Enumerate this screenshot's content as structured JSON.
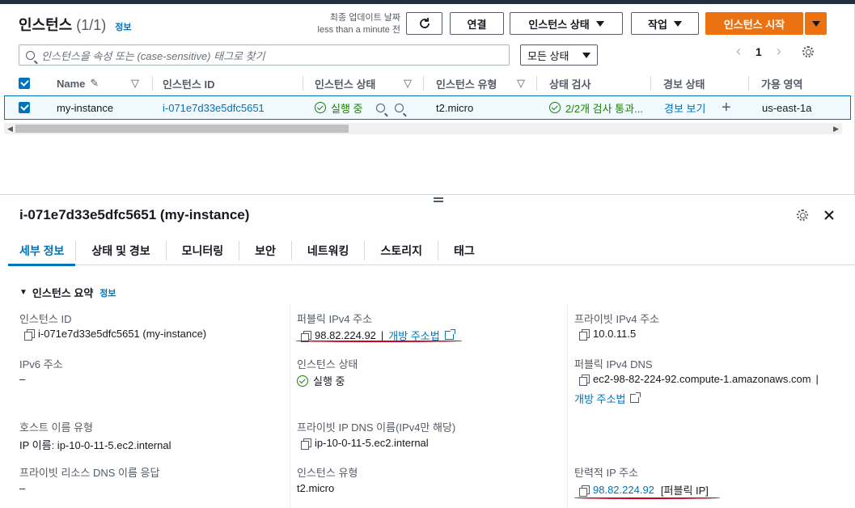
{
  "header": {
    "title": "인스턴스",
    "count": "(1/1)",
    "info": "정보",
    "updated_line1": "최종 업데이트 날짜",
    "updated_line2": "less than a minute 전",
    "connect": "연결",
    "instance_state": "인스턴스 상태",
    "actions": "작업",
    "launch": "인스턴스 시작"
  },
  "search": {
    "placeholder": "인스턴스을 속성 또는 (case-sensitive) 태그로 찾기"
  },
  "filter": {
    "selected": "모든 상태"
  },
  "pager": {
    "page": "1"
  },
  "table": {
    "columns": [
      "Name",
      "인스턴스 ID",
      "인스턴스 상태",
      "인스턴스 유형",
      "상태 검사",
      "경보 상태",
      "가용 영역"
    ],
    "row": {
      "name": "my-instance",
      "id": "i-071e7d33e5dfc5651",
      "state": "실행 중",
      "type": "t2.micro",
      "check": "2/2개 검사 통과...",
      "alarm": "경보 보기",
      "az": "us-east-1a"
    }
  },
  "detail": {
    "title": "i-071e7d33e5dfc5651 (my-instance)",
    "tabs": [
      "세부 정보",
      "상태 및 경보",
      "모니터링",
      "보안",
      "네트워킹",
      "스토리지",
      "태그"
    ],
    "section": "인스턴스 요약",
    "section_info": "정보",
    "fields": {
      "instance_id_label": "인스턴스 ID",
      "instance_id_value": "i-071e7d33e5dfc5651 (my-instance)",
      "public_ipv4_label": "퍼블릭 IPv4 주소",
      "public_ipv4_value": "98.82.224.92",
      "public_ipv4_sep": "|",
      "open_address": "개방 주소법",
      "private_ipv4_label": "프라이빗 IPv4 주소",
      "private_ipv4_value": "10.0.11.5",
      "ipv6_label": "IPv6 주소",
      "ipv6_value": "–",
      "state_label": "인스턴스 상태",
      "state_value": "실행 중",
      "public_dns_label": "퍼블릭 IPv4 DNS",
      "public_dns_value": "ec2-98-82-224-92.compute-1.amazonaws.com",
      "public_dns_sep": "|",
      "open_address2": "개방 주소법",
      "hostname_type_label": "호스트 이름 유형",
      "hostname_type_value": "IP 이름: ip-10-0-11-5.ec2.internal",
      "private_dns_label": "프라이빗 IP DNS 이름(IPv4만 해당)",
      "private_dns_value": "ip-10-0-11-5.ec2.internal",
      "resource_dns_label": "프라이빗 리소스 DNS 이름 응답",
      "resource_dns_value": "–",
      "type_label": "인스턴스 유형",
      "type_value": "t2.micro",
      "eip_label": "탄력적 IP 주소",
      "eip_value": "98.82.224.92",
      "eip_tag": "[퍼블릭 IP]"
    }
  }
}
